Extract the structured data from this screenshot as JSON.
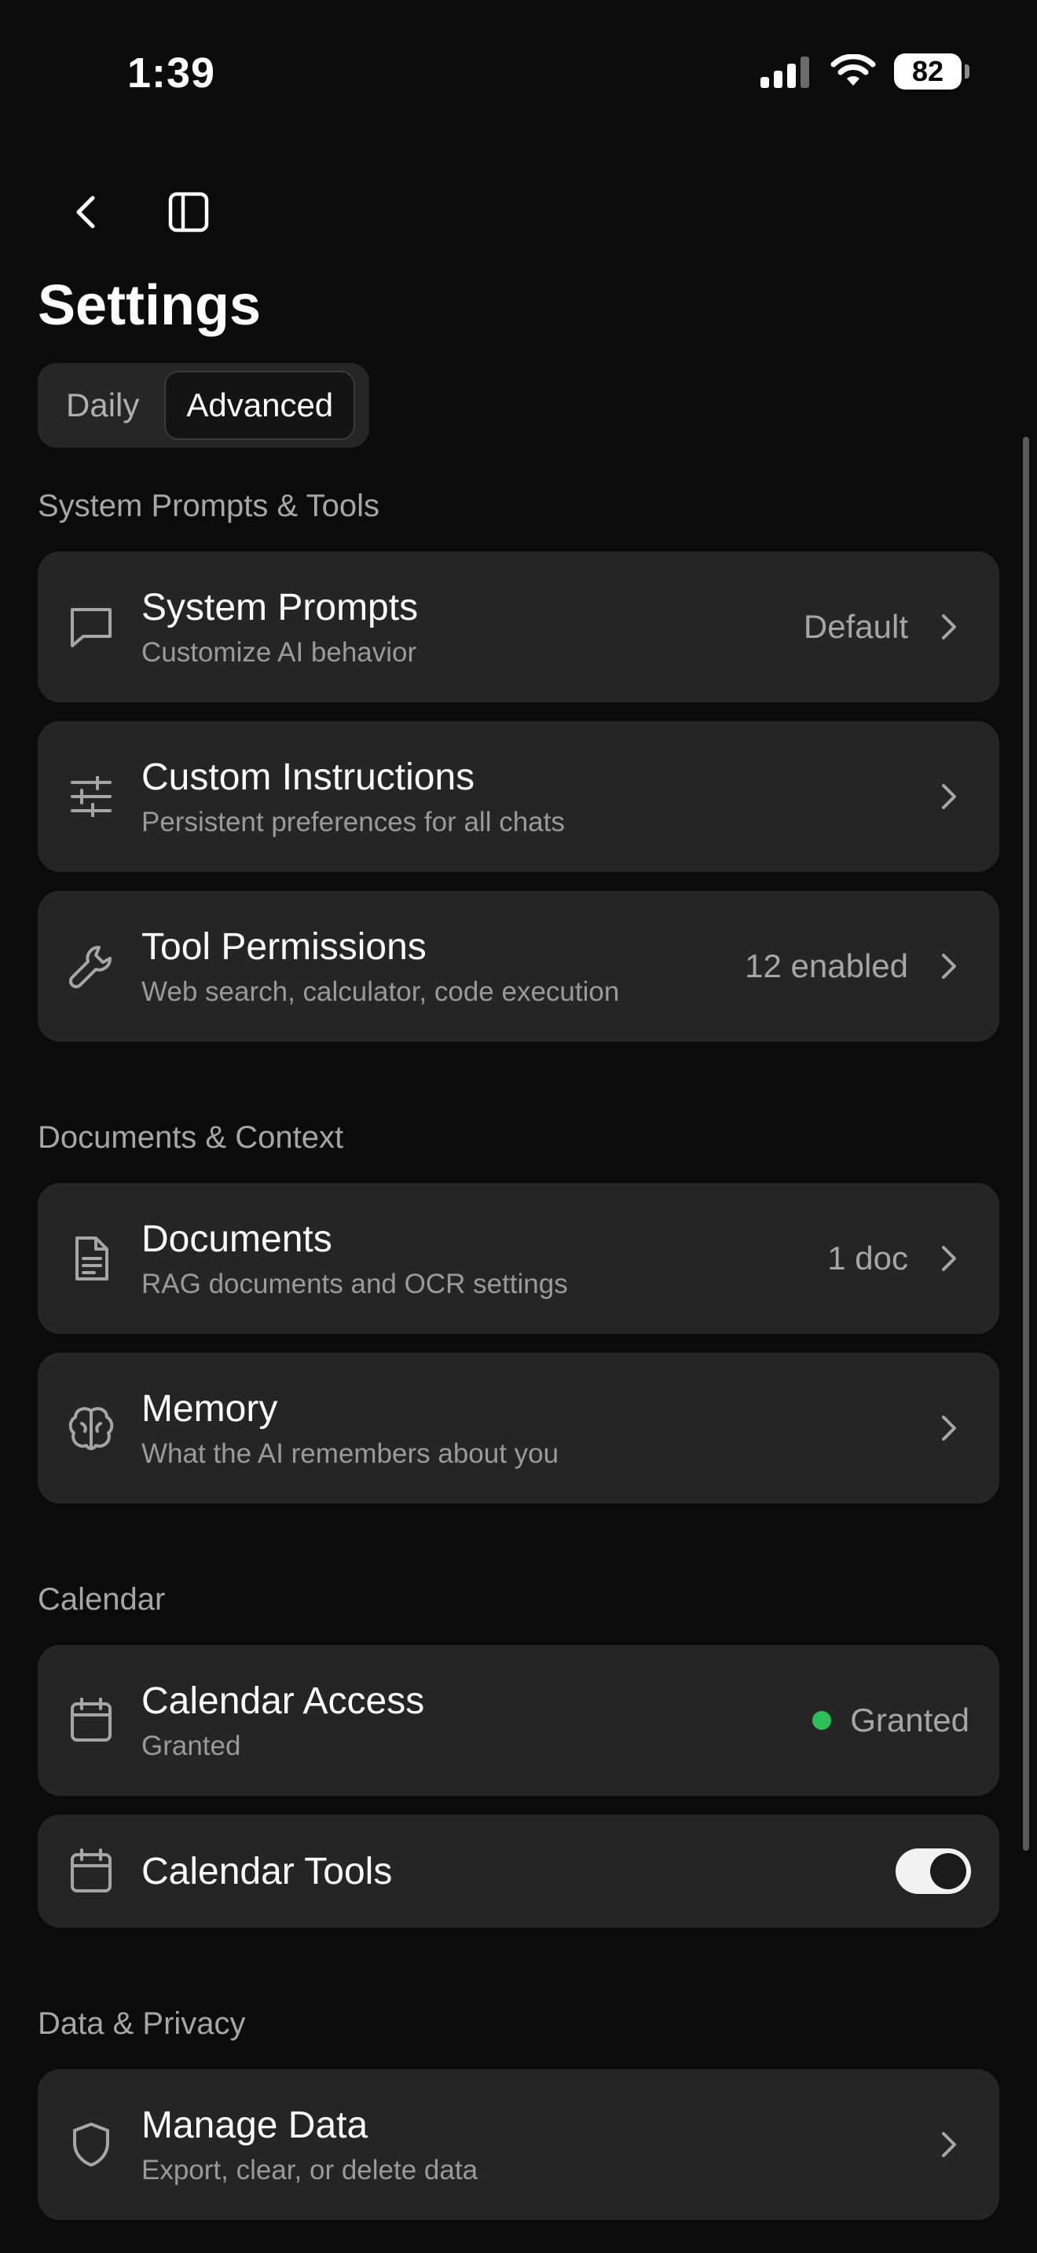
{
  "status_bar": {
    "time": "1:39",
    "battery": "82"
  },
  "header": {
    "title": "Settings"
  },
  "segmented": {
    "tabs": [
      "Daily",
      "Advanced"
    ],
    "selected": "Advanced"
  },
  "sections": [
    {
      "label": "System Prompts & Tools",
      "items": [
        {
          "title": "System Prompts",
          "subtitle": "Customize AI behavior",
          "value": "Default",
          "icon": "chat-bubble-icon"
        },
        {
          "title": "Custom Instructions",
          "subtitle": "Persistent preferences for all chats",
          "value": "",
          "icon": "sliders-icon"
        },
        {
          "title": "Tool Permissions",
          "subtitle": "Web search, calculator, code execution",
          "value": "12 enabled",
          "icon": "wrench-icon"
        }
      ]
    },
    {
      "label": "Documents & Context",
      "items": [
        {
          "title": "Documents",
          "subtitle": "RAG documents and OCR settings",
          "value": "1 doc",
          "icon": "document-icon"
        },
        {
          "title": "Memory",
          "subtitle": "What the AI remembers about you",
          "value": "",
          "icon": "brain-icon"
        }
      ]
    },
    {
      "label": "Calendar",
      "items": [
        {
          "title": "Calendar Access",
          "subtitle": "Granted",
          "value": "Granted",
          "status_color": "#2fbf5a",
          "icon": "calendar-icon"
        },
        {
          "title": "Calendar Tools",
          "toggle": true,
          "icon": "calendar-icon"
        }
      ]
    },
    {
      "label": "Data & Privacy",
      "items": [
        {
          "title": "Manage Data",
          "subtitle": "Export, clear, or delete data",
          "value": "",
          "icon": "shield-icon"
        }
      ]
    }
  ],
  "colors": {
    "background": "#0b0b0b",
    "card": "#252525",
    "accent_green": "#2fbf5a"
  }
}
